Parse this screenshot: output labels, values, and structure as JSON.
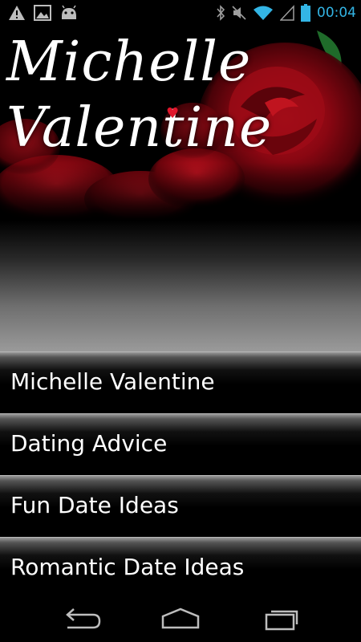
{
  "status_bar": {
    "time": "00:04",
    "accent_color": "#33b5e5",
    "left_icons": [
      "warning-icon",
      "image-icon",
      "android-icon"
    ],
    "right_icons": [
      "bluetooth-icon",
      "mute-icon",
      "wifi-icon",
      "signal-icon",
      "battery-icon"
    ]
  },
  "banner": {
    "title": "Michelle\nValentine",
    "image": "red-rose-image"
  },
  "menu": {
    "items": [
      {
        "label": "Michelle Valentine"
      },
      {
        "label": "Dating Advice"
      },
      {
        "label": "Fun Date Ideas"
      },
      {
        "label": "Romantic Date Ideas"
      }
    ]
  },
  "nav_bar": {
    "buttons": [
      "back-icon",
      "home-icon",
      "recents-icon"
    ]
  }
}
